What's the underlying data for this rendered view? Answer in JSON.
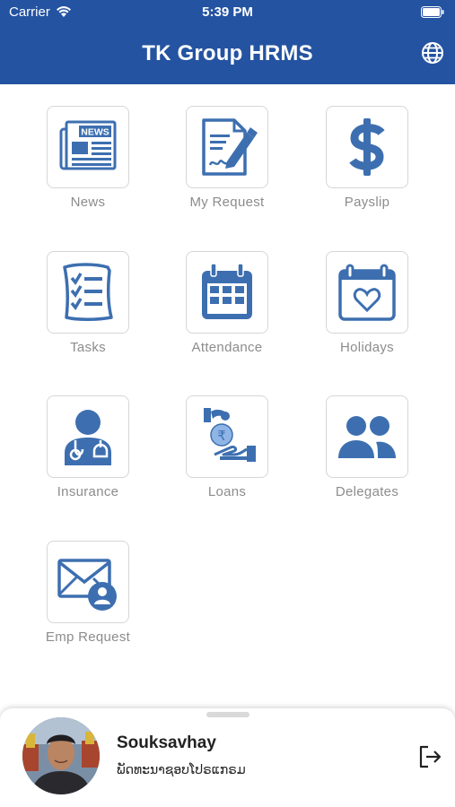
{
  "status": {
    "carrier": "Carrier",
    "time": "5:39 PM"
  },
  "header": {
    "title": "TK Group HRMS",
    "language_icon": "globe-icon"
  },
  "colors": {
    "brand": "#2453a1",
    "icon_blue": "#3d6fb0",
    "tile_border": "#d6d6d6",
    "label_gray": "#8c8c8c"
  },
  "menu": [
    {
      "label": "News",
      "icon": "newspaper-icon"
    },
    {
      "label": "My Request",
      "icon": "document-signature-icon"
    },
    {
      "label": "Payslip",
      "icon": "dollar-icon"
    },
    {
      "label": "Tasks",
      "icon": "checklist-icon"
    },
    {
      "label": "Attendance",
      "icon": "calendar-grid-icon"
    },
    {
      "label": "Holidays",
      "icon": "calendar-heart-icon"
    },
    {
      "label": "Insurance",
      "icon": "doctor-icon"
    },
    {
      "label": "Loans",
      "icon": "rupee-loan-icon"
    },
    {
      "label": "Delegates",
      "icon": "people-icon"
    },
    {
      "label": "Emp Request",
      "icon": "envelope-user-icon"
    }
  ],
  "news_icon_text": "NEWS",
  "user": {
    "name": "Souksavhay",
    "department": "ພັດທະນາຊອບໂປຣແກຣມ",
    "logout_icon": "logout-icon"
  }
}
